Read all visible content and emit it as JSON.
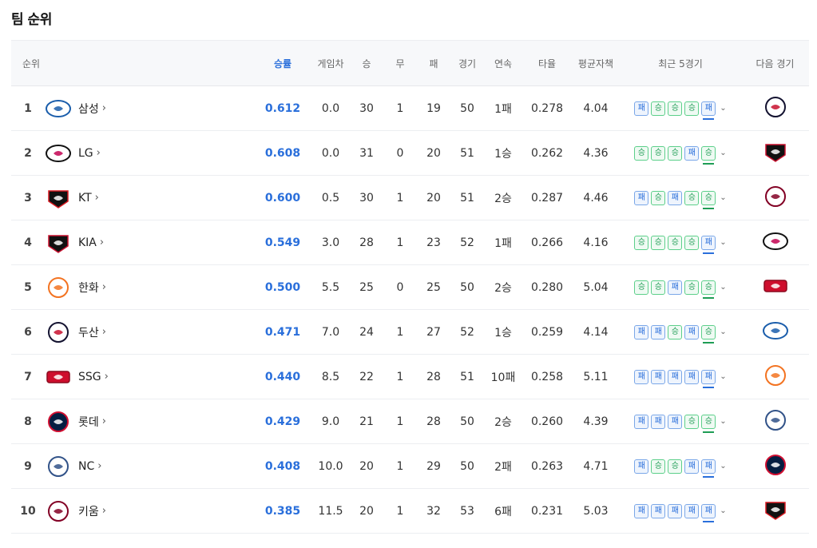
{
  "page_title": "팀 순위",
  "headers": {
    "rank": "순위",
    "winrate": "승률",
    "gb": "게임차",
    "w": "승",
    "d": "무",
    "l": "패",
    "games": "경기",
    "streak": "연속",
    "avg": "타율",
    "era": "평균자책",
    "recent": "최근 5경기",
    "next": "다음 경기"
  },
  "result_labels": {
    "W": "승",
    "L": "패"
  },
  "team_colors": {
    "Lions": "#1a5dab",
    "Twins": "#c30452",
    "Wiz": "#111111",
    "Tigers": "#c8102e",
    "Eagles": "#f37321",
    "Bears": "#131230",
    "Landers": "#ce0e2d",
    "Giants": "#041e42",
    "Dinos": "#315288",
    "Kiwoom": "#820024"
  },
  "rows": [
    {
      "rank": "1",
      "team": "삼성",
      "logo": "Lions",
      "winrate": "0.612",
      "gb": "0.0",
      "w": "30",
      "d": "1",
      "l": "19",
      "games": "50",
      "streak": "1패",
      "avg": "0.278",
      "era": "4.04",
      "recent": [
        "L",
        "W",
        "W",
        "W",
        "L"
      ],
      "next": "Bears"
    },
    {
      "rank": "2",
      "team": "LG",
      "logo": "Twins",
      "winrate": "0.608",
      "gb": "0.0",
      "w": "31",
      "d": "0",
      "l": "20",
      "games": "51",
      "streak": "1승",
      "avg": "0.262",
      "era": "4.36",
      "recent": [
        "W",
        "W",
        "W",
        "L",
        "W"
      ],
      "next": "Tigers"
    },
    {
      "rank": "3",
      "team": "KT",
      "logo": "Wiz",
      "winrate": "0.600",
      "gb": "0.5",
      "w": "30",
      "d": "1",
      "l": "20",
      "games": "51",
      "streak": "2승",
      "avg": "0.287",
      "era": "4.46",
      "recent": [
        "L",
        "W",
        "L",
        "W",
        "W"
      ],
      "next": "Kiwoom"
    },
    {
      "rank": "4",
      "team": "KIA",
      "logo": "Tigers",
      "winrate": "0.549",
      "gb": "3.0",
      "w": "28",
      "d": "1",
      "l": "23",
      "games": "52",
      "streak": "1패",
      "avg": "0.266",
      "era": "4.16",
      "recent": [
        "W",
        "W",
        "W",
        "W",
        "L"
      ],
      "next": "Twins"
    },
    {
      "rank": "5",
      "team": "한화",
      "logo": "Eagles",
      "winrate": "0.500",
      "gb": "5.5",
      "w": "25",
      "d": "0",
      "l": "25",
      "games": "50",
      "streak": "2승",
      "avg": "0.280",
      "era": "5.04",
      "recent": [
        "W",
        "W",
        "L",
        "W",
        "W"
      ],
      "next": "Landers"
    },
    {
      "rank": "6",
      "team": "두산",
      "logo": "Bears",
      "winrate": "0.471",
      "gb": "7.0",
      "w": "24",
      "d": "1",
      "l": "27",
      "games": "52",
      "streak": "1승",
      "avg": "0.259",
      "era": "4.14",
      "recent": [
        "L",
        "L",
        "W",
        "L",
        "W"
      ],
      "next": "Lions"
    },
    {
      "rank": "7",
      "team": "SSG",
      "logo": "Landers",
      "winrate": "0.440",
      "gb": "8.5",
      "w": "22",
      "d": "1",
      "l": "28",
      "games": "51",
      "streak": "10패",
      "avg": "0.258",
      "era": "5.11",
      "recent": [
        "L",
        "L",
        "L",
        "L",
        "L"
      ],
      "next": "Eagles"
    },
    {
      "rank": "8",
      "team": "롯데",
      "logo": "Giants",
      "winrate": "0.429",
      "gb": "9.0",
      "w": "21",
      "d": "1",
      "l": "28",
      "games": "50",
      "streak": "2승",
      "avg": "0.260",
      "era": "4.39",
      "recent": [
        "L",
        "L",
        "L",
        "W",
        "W"
      ],
      "next": "Dinos"
    },
    {
      "rank": "9",
      "team": "NC",
      "logo": "Dinos",
      "winrate": "0.408",
      "gb": "10.0",
      "w": "20",
      "d": "1",
      "l": "29",
      "games": "50",
      "streak": "2패",
      "avg": "0.263",
      "era": "4.71",
      "recent": [
        "L",
        "W",
        "W",
        "L",
        "L"
      ],
      "next": "Giants"
    },
    {
      "rank": "10",
      "team": "키움",
      "logo": "Kiwoom",
      "winrate": "0.385",
      "gb": "11.5",
      "w": "20",
      "d": "1",
      "l": "32",
      "games": "53",
      "streak": "6패",
      "avg": "0.231",
      "era": "5.03",
      "recent": [
        "L",
        "L",
        "L",
        "L",
        "L"
      ],
      "next": "Wiz"
    }
  ]
}
